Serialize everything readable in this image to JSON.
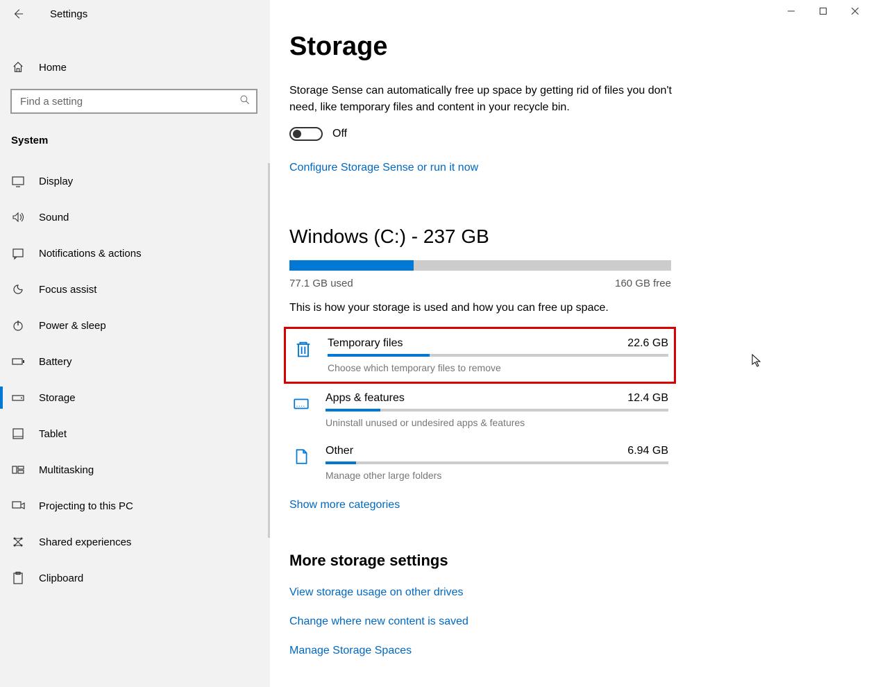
{
  "window": {
    "title": "Settings"
  },
  "sidebar": {
    "home": "Home",
    "search_placeholder": "Find a setting",
    "section": "System",
    "items": [
      {
        "label": "Display"
      },
      {
        "label": "Sound"
      },
      {
        "label": "Notifications & actions"
      },
      {
        "label": "Focus assist"
      },
      {
        "label": "Power & sleep"
      },
      {
        "label": "Battery"
      },
      {
        "label": "Storage"
      },
      {
        "label": "Tablet"
      },
      {
        "label": "Multitasking"
      },
      {
        "label": "Projecting to this PC"
      },
      {
        "label": "Shared experiences"
      },
      {
        "label": "Clipboard"
      }
    ]
  },
  "main": {
    "title": "Storage",
    "description": "Storage Sense can automatically free up space by getting rid of files you don't need, like temporary files and content in your recycle bin.",
    "toggle_label": "Off",
    "configure_link": "Configure Storage Sense or run it now",
    "drive_heading": "Windows (C:) - 237 GB",
    "used_text": "77.1 GB used",
    "free_text": "160 GB free",
    "usage_percent": 32.5,
    "usage_subtext": "This is how your storage is used and how you can free up space.",
    "categories": [
      {
        "title": "Temporary files",
        "size": "22.6 GB",
        "sub": "Choose which temporary files to remove",
        "percent": 30
      },
      {
        "title": "Apps & features",
        "size": "12.4 GB",
        "sub": "Uninstall unused or undesired apps & features",
        "percent": 16
      },
      {
        "title": "Other",
        "size": "6.94 GB",
        "sub": "Manage other large folders",
        "percent": 9
      }
    ],
    "show_more": "Show more categories",
    "more_heading": "More storage settings",
    "more_links": [
      "View storage usage on other drives",
      "Change where new content is saved",
      "Manage Storage Spaces"
    ]
  }
}
